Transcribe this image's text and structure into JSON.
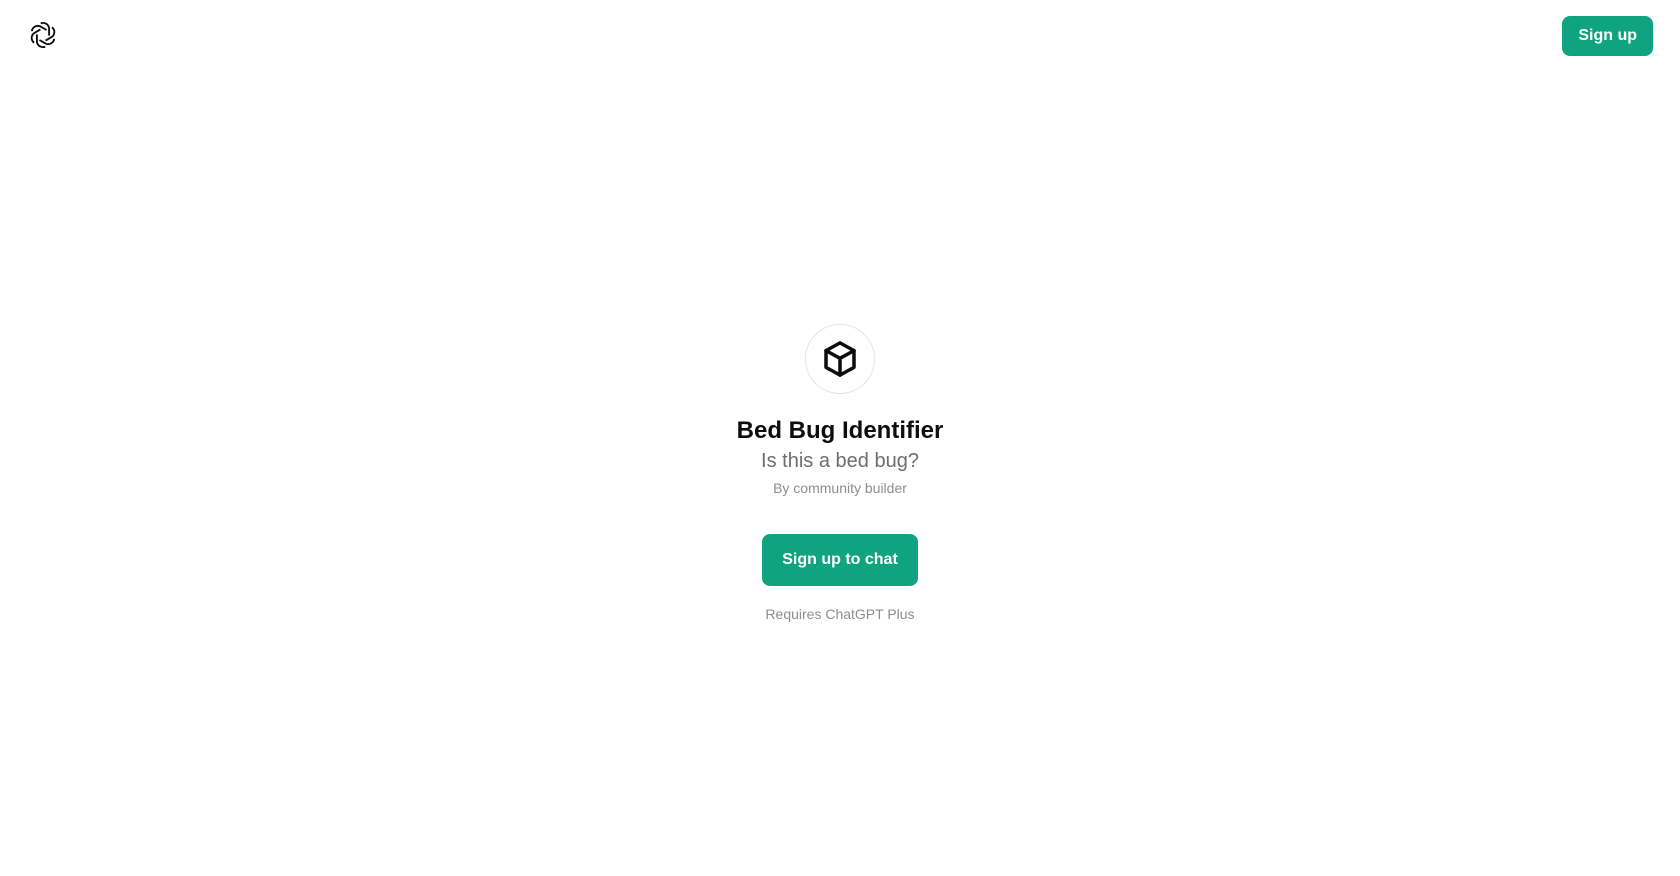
{
  "header": {
    "logo_icon": "openai-logo-icon",
    "signup_label": "Sign up",
    "accent_color": "#10a37f"
  },
  "gpt": {
    "avatar_icon": "cube-icon",
    "title": "Bed Bug Identifier",
    "description": "Is this a bed bug?",
    "author": "By community builder",
    "cta_label": "Sign up to chat",
    "requirement": "Requires ChatGPT Plus"
  }
}
